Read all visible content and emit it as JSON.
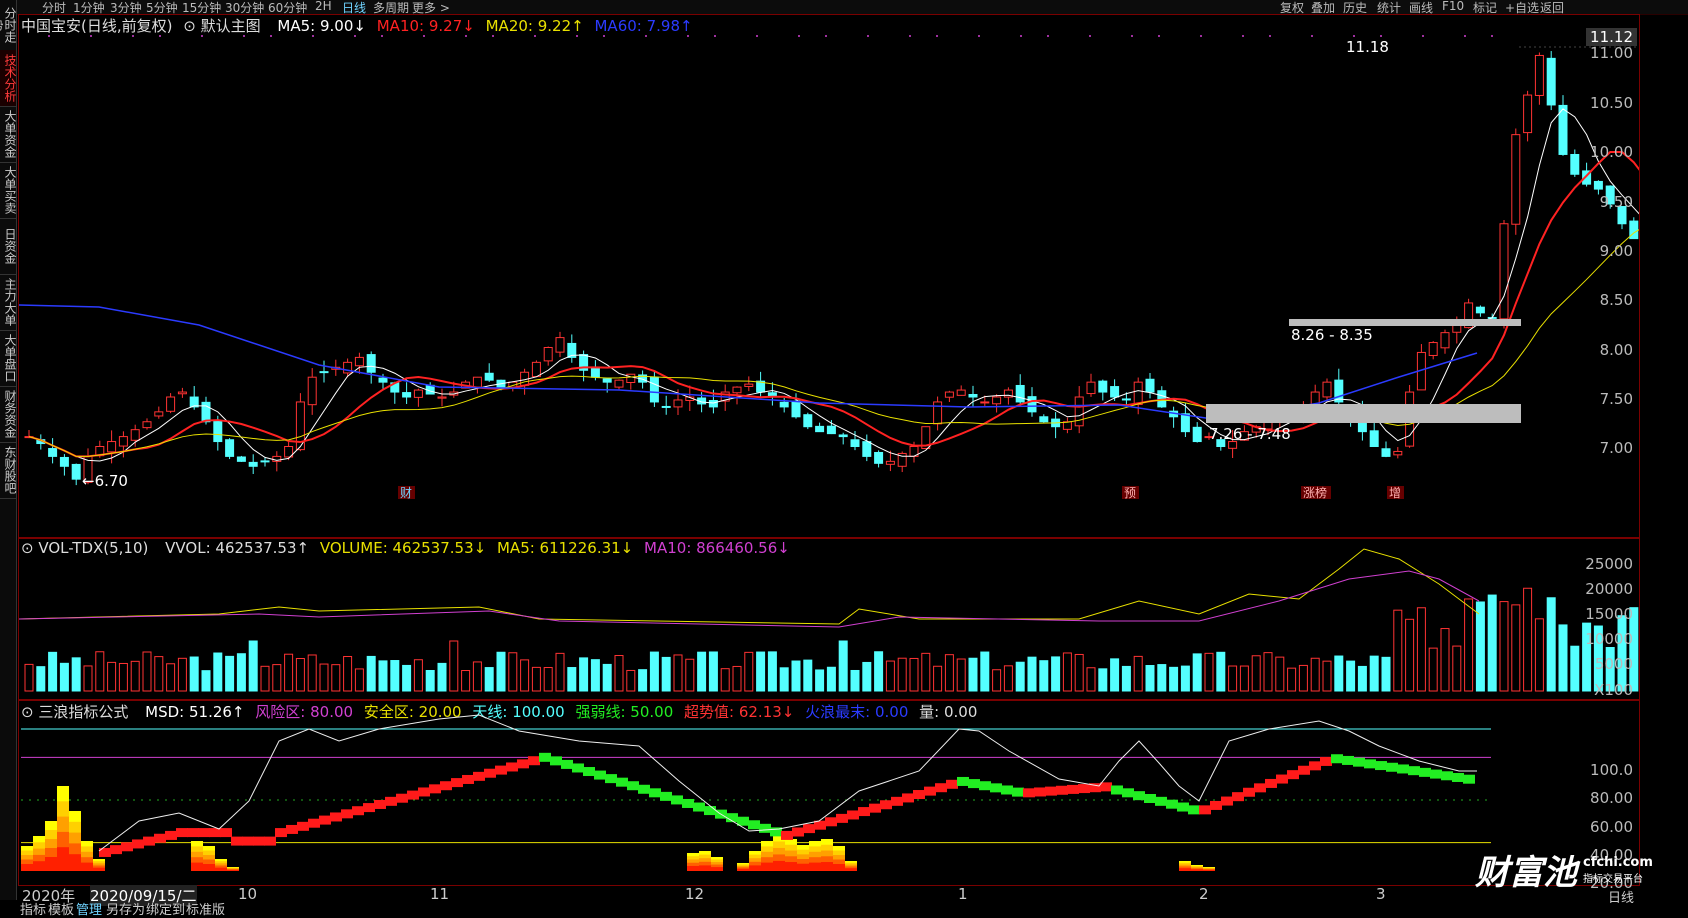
{
  "topbar": {
    "timeframes": [
      "分时",
      "1分钟",
      "3分钟",
      "5分钟",
      "15分钟",
      "30分钟",
      "60分钟",
      "2H",
      "日线",
      "多周期",
      "更多 >"
    ],
    "selected_timeframe": "日线",
    "right_buttons": [
      "复权",
      "叠加",
      "历史",
      "统计",
      "画线",
      "F10",
      "标记",
      "+自选",
      "返回"
    ]
  },
  "sidebar": {
    "tabs": [
      "分时走势",
      "技术分析",
      "大单资金",
      "大单买卖",
      "日资金",
      "主力大单",
      "大单盘口",
      "财务资金",
      "东财股吧"
    ],
    "active_tab": "技术分析"
  },
  "main_chart": {
    "stock": "中国宝安(日线,前复权)",
    "template": "默认主图",
    "ma5": "MA5: 9.00↓",
    "ma10": "MA10: 9.27↓",
    "ma20": "MA20: 9.22↑",
    "ma60": "MA60: 7.98↑",
    "price_box": "11.12",
    "y_ticks": [
      "11.00",
      "10.50",
      "10.00",
      "9.50",
      "9.00",
      "8.50",
      "8.00",
      "7.50",
      "7.00"
    ],
    "high_label": "11.18",
    "low_label": "←6.70",
    "zone_upper": "8.26 - 8.35",
    "zone_lower": "7.26 - 7.48",
    "event_labels": [
      "财",
      "预",
      "涨榜",
      "增"
    ]
  },
  "volume_chart": {
    "name": "VOL-TDX(5,10)",
    "vvol": "VVOL: 462537.53↑",
    "volume": "VOLUME: 462537.53↓",
    "ma5": "MA5: 611226.31↓",
    "ma10": "MA10: 866460.56↓",
    "y_ticks": [
      "25000",
      "20000",
      "15000",
      "10000",
      "5000"
    ],
    "unit": "X100"
  },
  "indicator_chart": {
    "name": "三浪指标公式",
    "msd": "MSD: 51.26↑",
    "risk": "风险区: 80.00",
    "safe": "安全区: 20.00",
    "sky": "天线: 100.00",
    "strong": "强弱线: 50.00",
    "over": "超势值: 62.13↓",
    "wave": "火浪最末: 0.00",
    "qty": "量: 0.00",
    "y_ticks": [
      "100.0",
      "80.00",
      "60.00",
      "40.00",
      "20.00"
    ]
  },
  "x_axis": {
    "year": "2020年",
    "cursor_date": "2020/09/15/二",
    "months": [
      "10",
      "11",
      "12",
      "1",
      "2",
      "3"
    ]
  },
  "bottombar": {
    "buttons": [
      "指标",
      "模板",
      "管理",
      "另存为",
      "绑定到",
      "标准版"
    ],
    "selected": "管理",
    "period": "日线"
  },
  "watermark": {
    "brand": "财富池",
    "site": "cfchi.com",
    "slogan": "指标交易平台"
  },
  "colors": {
    "up": "#ff3333",
    "down": "#54ffff",
    "ma5": "#ffffff",
    "ma10": "#ff2222",
    "ma20": "#e8e000",
    "ma60": "#2b3bff",
    "frame": "#7a0000"
  }
}
